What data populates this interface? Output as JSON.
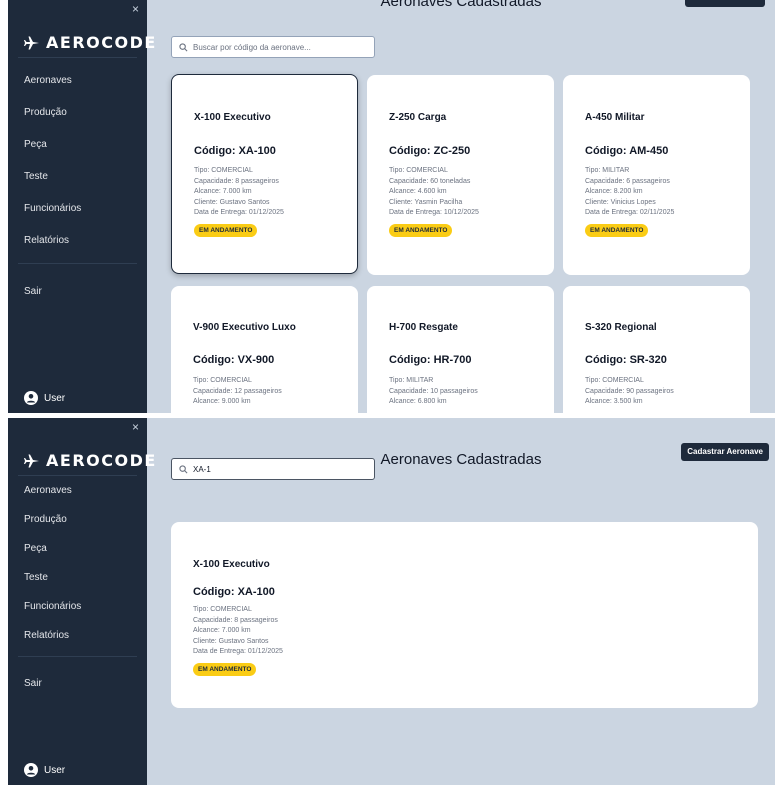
{
  "sidebar": {
    "close_symbol": "×",
    "logo_text": "AEROCODE",
    "logo_icon": "airplane-icon",
    "items": [
      {
        "label": "Aeronaves"
      },
      {
        "label": "Produção"
      },
      {
        "label": "Peça"
      },
      {
        "label": "Teste"
      },
      {
        "label": "Funcionários"
      },
      {
        "label": "Relatórios"
      }
    ],
    "logout_label": "Sair",
    "user_label": "User"
  },
  "page": {
    "title": "Aeronaves Cadastradas",
    "add_button_label": "Cadastrar Aeronave"
  },
  "search": {
    "placeholder": "Buscar por código da aeronave...",
    "value": "XA-1"
  },
  "cards": [
    {
      "name": "X-100 Executivo",
      "code": "Código: XA-100",
      "tipo": "Tipo: COMERCIAL",
      "capacidade": "Capacidade: 8 passageiros",
      "alcance": "Alcance: 7.000 km",
      "cliente": "Cliente: Gustavo Santos",
      "entrega": "Data de Entrega: 01/12/2025",
      "status": "EM ANDAMENTO"
    },
    {
      "name": "Z-250 Carga",
      "code": "Código: ZC-250",
      "tipo": "Tipo: COMERCIAL",
      "capacidade": "Capacidade: 60 toneladas",
      "alcance": "Alcance: 4.600 km",
      "cliente": "Cliente: Yasmin Pacilha",
      "entrega": "Data de Entrega: 10/12/2025",
      "status": "EM ANDAMENTO"
    },
    {
      "name": "A-450 Militar",
      "code": "Código: AM-450",
      "tipo": "Tipo: MILITAR",
      "capacidade": "Capacidade: 6 passageiros",
      "alcance": "Alcance: 8.200 km",
      "cliente": "Cliente: Vinicius Lopes",
      "entrega": "Data de Entrega: 02/11/2025",
      "status": "EM ANDAMENTO"
    },
    {
      "name": "V-900 Executivo Luxo",
      "code": "Código: VX-900",
      "tipo": "Tipo: COMERCIAL",
      "capacidade": "Capacidade: 12 passageiros",
      "alcance": "Alcance: 9.000 km"
    },
    {
      "name": "H-700 Resgate",
      "code": "Código: HR-700",
      "tipo": "Tipo: MILITAR",
      "capacidade": "Capacidade: 10 passageiros",
      "alcance": "Alcance: 6.800 km"
    },
    {
      "name": "S-320 Regional",
      "code": "Código: SR-320",
      "tipo": "Tipo: COMERCIAL",
      "capacidade": "Capacidade: 90 passageiros",
      "alcance": "Alcance: 3.500 km"
    }
  ]
}
